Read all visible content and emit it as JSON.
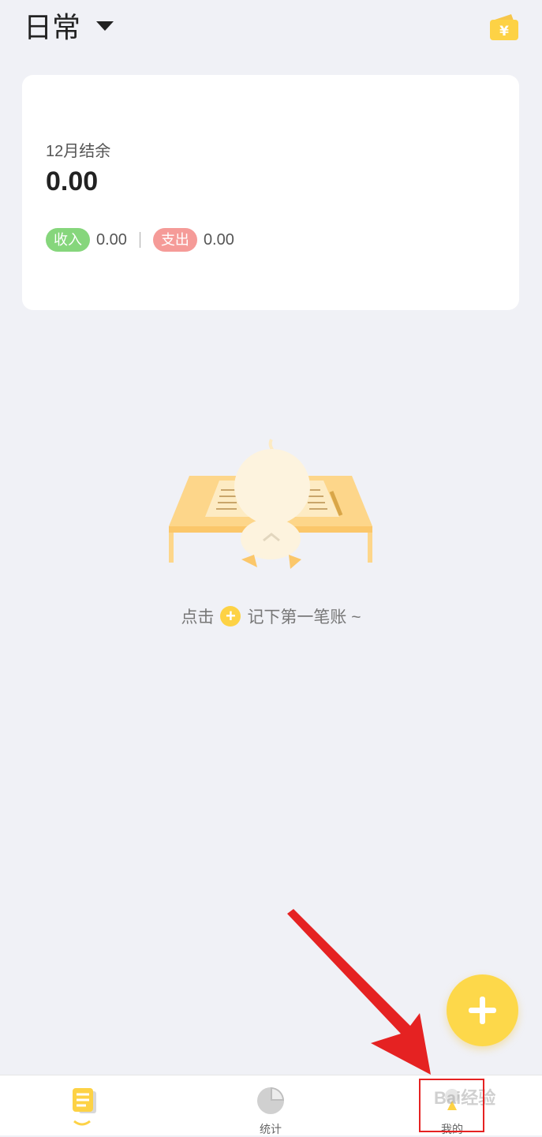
{
  "header": {
    "book_title": "日常",
    "dropdown_icon": "caret-down-icon",
    "wallet_icon": "yen-wallet-icon",
    "wallet_symbol": "¥"
  },
  "summary": {
    "month_label": "12月结余",
    "balance": "0.00",
    "income_label": "收入",
    "income_value": "0.00",
    "separator": "|",
    "expense_label": "支出",
    "expense_value": "0.00"
  },
  "empty_state": {
    "illustration": "duck-at-desk-illustration",
    "hint_prefix": "点击",
    "hint_suffix": "记下第一笔账 ~"
  },
  "fab": {
    "icon": "plus-icon"
  },
  "tabbar": {
    "tabs": [
      {
        "label": "",
        "icon": "journal-icon",
        "active": true
      },
      {
        "label": "统计",
        "icon": "pie-chart-icon",
        "active": false
      },
      {
        "label": "我的",
        "icon": "profile-icon",
        "active": false
      }
    ]
  },
  "annotation": {
    "watermark": "Bai经验"
  },
  "colors": {
    "accent": "#fdd84a",
    "income": "#86d67c",
    "expense": "#f59b98",
    "background": "#f0f1f6",
    "annotation": "#e52222"
  }
}
